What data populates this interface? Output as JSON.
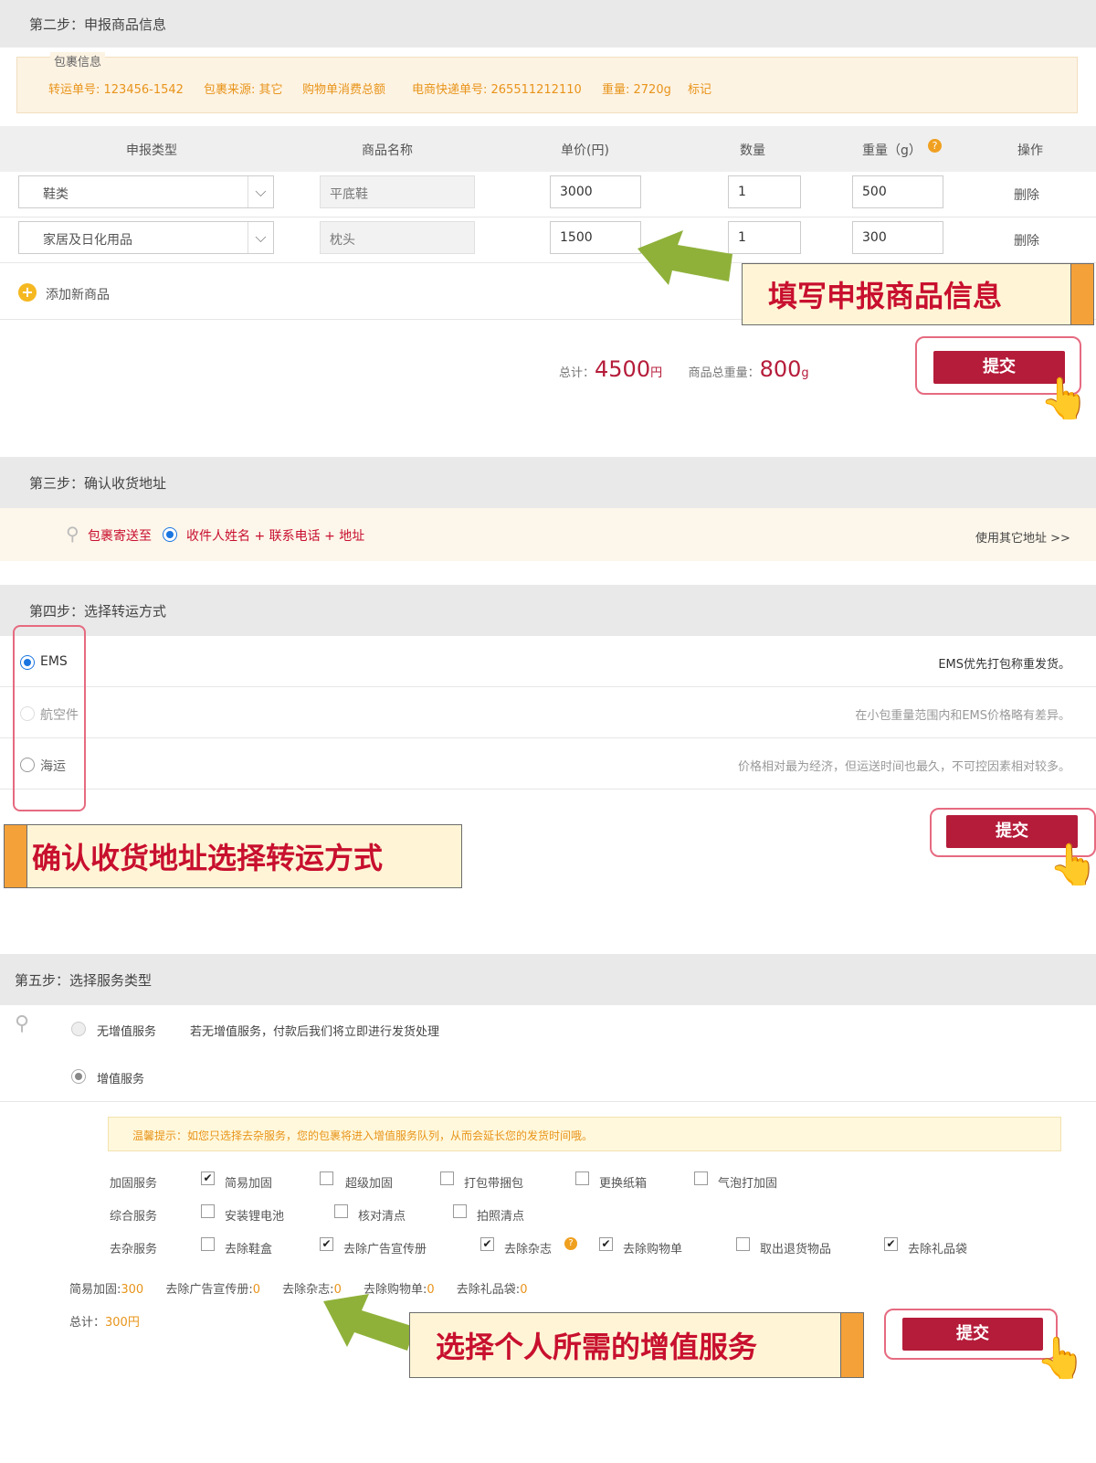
{
  "step2": {
    "title": "第二步：申报商品信息",
    "package_info_label": "包裹信息",
    "package_info": {
      "transfer_no": "转运单号: 123456-1542",
      "source": "包裹来源: 其它",
      "shopping": "购物单消费总额",
      "express_no": "电商快递单号: 265511212110",
      "weight": "重量: 2720g",
      "mark": "标记"
    },
    "columns": [
      "申报类型",
      "商品名称",
      "单价(円)",
      "数量",
      "重量（g）",
      "操作"
    ],
    "rows": [
      {
        "type": "鞋类",
        "name": "平底鞋",
        "price": "3000",
        "qty": "1",
        "weight": "500",
        "action": "删除"
      },
      {
        "type": "家居及日化用品",
        "name": "枕头",
        "price": "1500",
        "qty": "1",
        "weight": "300",
        "action": "删除"
      }
    ],
    "add_item": "添加新商品",
    "total_label": "总计：",
    "total_value": "4500",
    "total_unit": "円",
    "weight_label": "商品总重量：",
    "weight_value": "800",
    "weight_unit": "g",
    "submit": "提交",
    "callout": "填写申报商品信息"
  },
  "step3": {
    "title": "第三步：确认收货地址",
    "send_to": "包裹寄送至",
    "address": "收件人姓名 + 联系电话 + 地址",
    "other_address": "使用其它地址 >>"
  },
  "step4": {
    "title": "第四步：选择转运方式",
    "options": [
      {
        "label": "EMS",
        "desc": "EMS优先打包称重发货。",
        "selected": true
      },
      {
        "label": "航空件",
        "desc": "在小包重量范围内和EMS价格略有差异。",
        "selected": false
      },
      {
        "label": "海运",
        "desc": "价格相对最为经济，但运送时间也最久，不可控因素相对较多。",
        "selected": false
      }
    ],
    "submit": "提交",
    "callout": "确认收货地址选择转运方式"
  },
  "step5": {
    "title": "第五步：选择服务类型",
    "no_service": "无增值服务",
    "no_service_desc": "若无增值服务，付款后我们将立即进行发货处理",
    "value_service": "增值服务",
    "tip": "温馨提示：如您只选择去杂服务，您的包裹将进入增值服务队列，从而会延长您的发货时间哦。",
    "groups": [
      {
        "label": "加固服务",
        "items": [
          {
            "name": "简易加固",
            "checked": true
          },
          {
            "name": "超级加固",
            "checked": false
          },
          {
            "name": "打包带捆包",
            "checked": false
          },
          {
            "name": "更换纸箱",
            "checked": false
          },
          {
            "name": "气泡打加固",
            "checked": false
          }
        ]
      },
      {
        "label": "综合服务",
        "items": [
          {
            "name": "安装锂电池",
            "checked": false
          },
          {
            "name": "核对清点",
            "checked": false
          },
          {
            "name": "拍照清点",
            "checked": false
          }
        ]
      },
      {
        "label": "去杂服务",
        "items": [
          {
            "name": "去除鞋盒",
            "checked": false
          },
          {
            "name": "去除广告宣传册",
            "checked": true
          },
          {
            "name": "去除杂志",
            "checked": true
          },
          {
            "name": "去除购物单",
            "checked": true
          },
          {
            "name": "取出退货物品",
            "checked": false
          },
          {
            "name": "去除礼品袋",
            "checked": true
          }
        ]
      }
    ],
    "fees": [
      {
        "label": "简易加固:",
        "value": "300"
      },
      {
        "label": "去除广告宣传册:",
        "value": "0"
      },
      {
        "label": "去除杂志:",
        "value": "0"
      },
      {
        "label": "去除购物单:",
        "value": "0"
      },
      {
        "label": "去除礼品袋:",
        "value": "0"
      }
    ],
    "total_label": "总计：",
    "total_value": "300円",
    "submit": "提交",
    "callout": "选择个人所需的增值服务"
  },
  "colors": {
    "accent_red": "#b51c3a",
    "orange": "#e8941a",
    "callout_bg": "#fff5d6",
    "callout_text": "#c8102e",
    "arrow_green": "#8fb13a"
  }
}
